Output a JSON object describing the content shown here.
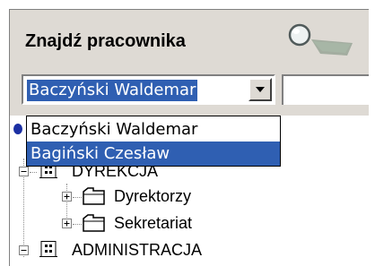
{
  "panel": {
    "title": "Znajdź pracownika",
    "search_icon": "magnifier-icon"
  },
  "combo": {
    "value": "Baczyński Waldemar",
    "button_icon": "chevron-down-icon"
  },
  "dropdown": {
    "options": [
      "Baczyński Waldemar",
      "Bagiński Czesław"
    ],
    "highlighted_index": 1
  },
  "tree": {
    "items": [
      {
        "label": "DYREKCJA",
        "level": 0,
        "expanded": true,
        "icon": "org-unit-icon"
      },
      {
        "label": "Dyrektorzy",
        "level": 1,
        "expanded": false,
        "icon": "folder-icon"
      },
      {
        "label": "Sekretariat",
        "level": 1,
        "expanded": false,
        "icon": "folder-icon"
      },
      {
        "label": "ADMINISTRACJA",
        "level": 0,
        "expanded": true,
        "icon": "org-unit-icon"
      }
    ]
  },
  "colors": {
    "panel_bg": "#dedad4",
    "selection": "#2f5fb2"
  }
}
